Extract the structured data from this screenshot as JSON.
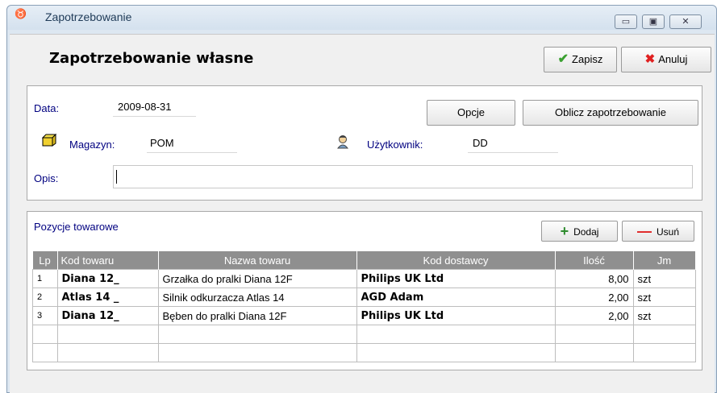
{
  "window": {
    "title": "Zapotrzebowanie",
    "controls": {
      "minimize": "▭",
      "maximize": "▣",
      "close": "✕"
    }
  },
  "header": {
    "title": "Zapotrzebowanie własne",
    "save_label": "Zapisz",
    "cancel_label": "Anuluj"
  },
  "form": {
    "data_label": "Data:",
    "data_value": "2009-08-31",
    "opcje_label": "Opcje",
    "oblicz_label": "Oblicz zapotrzebowanie",
    "magazyn_label": "Magazyn:",
    "magazyn_value": "POM",
    "uzytkownik_label": "Użytkownik:",
    "uzytkownik_value": "DD",
    "opis_label": "Opis:",
    "opis_value": ""
  },
  "items": {
    "section_title": "Pozycje towarowe",
    "add_label": "Dodaj",
    "remove_label": "Usuń",
    "columns": [
      "Lp",
      "Kod towaru",
      "Nazwa towaru",
      "Kod dostawcy",
      "Ilość",
      "Jm"
    ],
    "rows": [
      {
        "lp": "1",
        "kod": "Diana 12_",
        "nazwa": "Grzałka do pralki Diana 12F",
        "dostawca": "Philips UK Ltd",
        "ilosc": "8,00",
        "jm": "szt"
      },
      {
        "lp": "2",
        "kod": "Atlas 14 _",
        "nazwa": "Silnik odkurzacza Atlas 14",
        "dostawca": "AGD Adam",
        "ilosc": "2,00",
        "jm": "szt"
      },
      {
        "lp": "3",
        "kod": "Diana 12_",
        "nazwa": "Bęben do pralki Diana 12F",
        "dostawca": "Philips UK Ltd",
        "ilosc": "2,00",
        "jm": "szt"
      }
    ]
  },
  "colors": {
    "grid_header": "#8f8f8f",
    "label_blue": "#000080",
    "save_green": "#3aa030",
    "cancel_red": "#e02020"
  }
}
